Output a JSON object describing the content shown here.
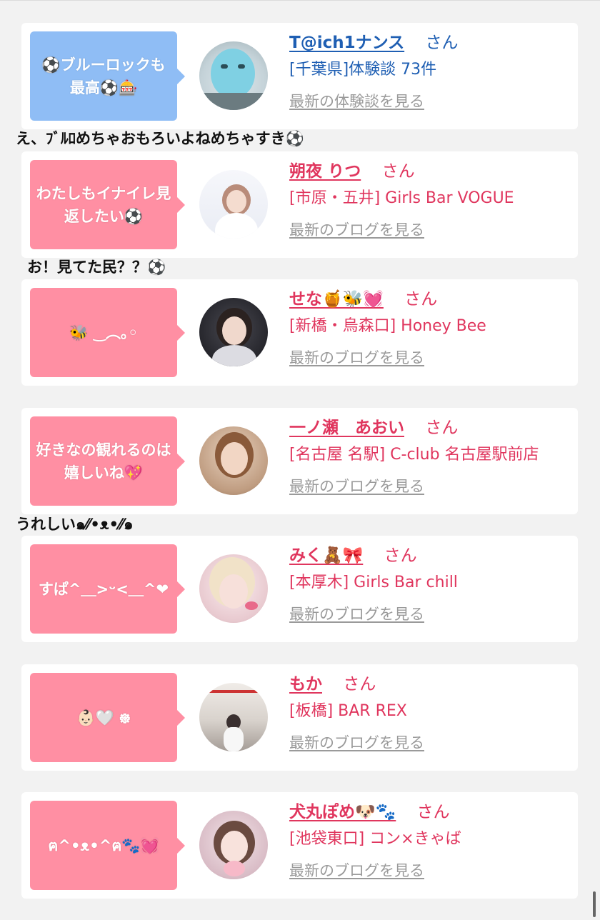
{
  "posts": [
    {
      "bubble": "⚽ブルーロックも最高⚽🎰",
      "name": "T@ich1ナンス",
      "honorific": "さん",
      "location": "[千葉県]体験談 73件",
      "link": "最新の体験談を見る",
      "theme": "blue",
      "reply": "え、ﾌﾞﾙﾛめちゃおもろいよねめちゃすき⚽"
    },
    {
      "bubble": "わたしもイナイレ見返したい⚽",
      "name": "朔夜 りつ",
      "honorific": "さん",
      "location": "[市原・五井] Girls Bar VOGUE",
      "link": "最新のブログを見る",
      "theme": "pink",
      "reply": "お！見てた民？？⚽"
    },
    {
      "bubble": "🐝 ‿︵｡◦",
      "name": "せな🍯🐝💓",
      "honorific": "さん",
      "location": "[新橋・烏森口] Honey Bee",
      "link": "最新のブログを見る",
      "theme": "pink",
      "reply": ""
    },
    {
      "bubble": "好きなの観れるのは嬉しいね💖",
      "name": "一ノ瀬　あおい",
      "honorific": "さん",
      "location": "[名古屋 名駅] C-club 名古屋駅前店",
      "link": "最新のブログを見る",
      "theme": "pink",
      "reply": "うれしい๑⁄⁄•ᴥ•⁄⁄๑"
    },
    {
      "bubble": "すぱ^＿>ᵕ<＿^❤",
      "name": "みく🧸🎀",
      "honorific": "さん",
      "location": "[本厚木] Girls Bar chill",
      "link": "最新のブログを見る",
      "theme": "pink",
      "reply": ""
    },
    {
      "bubble": "👶🏻🤍 ᪥",
      "name": "もか",
      "honorific": "さん",
      "location": "[板橋] BAR REX",
      "link": "最新のブログを見る",
      "theme": "pink",
      "reply": ""
    },
    {
      "bubble": "ฅ^•ᴥ•^ฅ🐾💓",
      "name": "犬丸ぽめ🐶🐾",
      "honorific": "さん",
      "location": "[池袋東口] コン×きゃば",
      "link": "最新のブログを見る",
      "theme": "pink",
      "reply": ""
    }
  ],
  "colors": {
    "page_background": "#f2f2f2",
    "card_background": "#ffffff",
    "bubble_blue": "#8fbdf5",
    "bubble_pink": "#ff8fa3",
    "text_blue": "#1f5fb3",
    "text_pink": "#e0365e",
    "link_gray": "#9a9a9a"
  },
  "avatars": [
    "blue-character-plush-photo",
    "woman-portrait-photo",
    "woman-portrait-photo",
    "woman-portrait-photo",
    "woman-portrait-photo",
    "room-interior-photo",
    "woman-portrait-photo"
  ]
}
